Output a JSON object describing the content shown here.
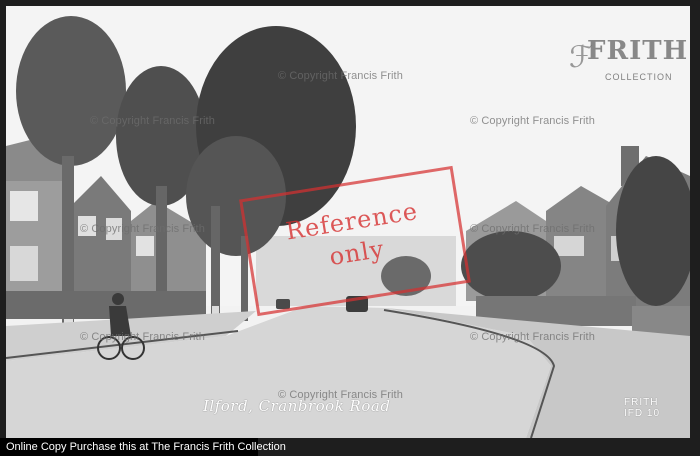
{
  "photo": {
    "caption": "Ilford, Cranbrook Road",
    "frith_code_line1": "FRITH",
    "frith_code_line2": "IFD 10"
  },
  "watermarks": {
    "copyright": "© Copyright Francis Frith",
    "reference_line1": "Reference",
    "reference_line2": "only"
  },
  "logo": {
    "name": "FRITH",
    "tagline": "COLLECTION"
  },
  "footer": {
    "text": "Online Copy Purchase this at The Francis Frith Collection"
  }
}
